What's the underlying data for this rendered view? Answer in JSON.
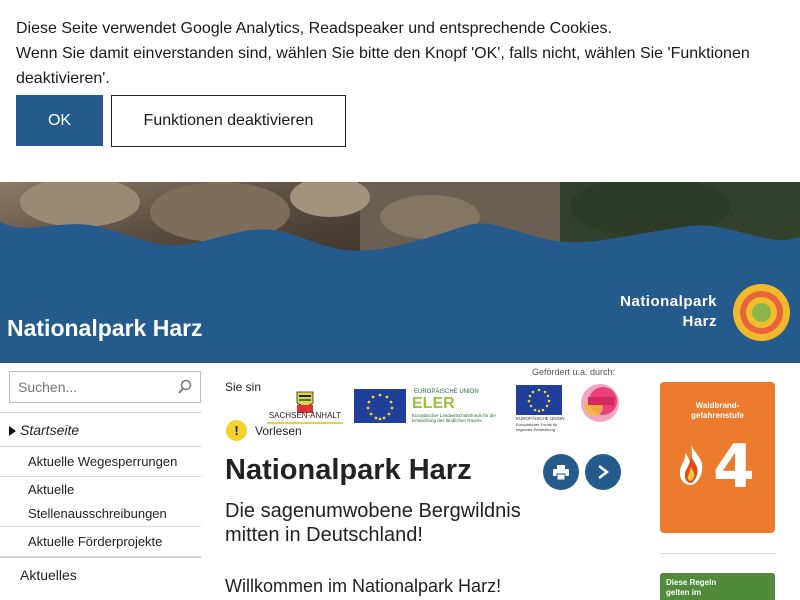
{
  "cookie": {
    "line1": "Diese Seite verwendet Google Analytics, Readspeaker und entsprechende Cookies.",
    "line2": "Wenn Sie damit einverstanden sind, wählen Sie bitte den Knopf 'OK', falls nicht, wählen Sie 'Funktionen deaktivieren'.",
    "ok_label": "OK",
    "deactivate_label": "Funktionen deaktivieren"
  },
  "header": {
    "site_title": "Nationalpark Harz",
    "logo_text": "Nationalpark Harz"
  },
  "sidebar": {
    "search_placeholder": "Suchen...",
    "nav": {
      "home": "Startseite",
      "sub": [
        "Aktuelle Wegesperrungen",
        "Aktuelle Stellenausschreibungen",
        "Aktuelle Förderprojekte"
      ],
      "aktuelles": "Aktuelles"
    }
  },
  "main": {
    "partial_text": "Sie sin",
    "sponsor_label": "Gefördert u.a. durch:",
    "logos": {
      "sachsen_anhalt": "SACHSEN-ANHALT",
      "eler_title": "EUROPÄISCHE UNION",
      "eler_big": "ELER",
      "eler_desc": "Europäischer Landwirtschaftsfonds für die Entwicklung des ländlichen Raums",
      "efre_title": "EUROPÄISCHE UNION",
      "efre_desc": "Europäischer Fonds für regionale Entwicklung"
    },
    "readspeaker_label": "Vorlesen",
    "title": "Nationalpark Harz",
    "subtitle": "Die sagenumwobene Bergwildnis mitten in Deutschland!",
    "welcome": "Willkommen im Nationalpark Harz!"
  },
  "right": {
    "fire_title": "Waldbrand-\ngefahrenstufe",
    "fire_level": "4",
    "rules_text": "Diese Regeln\ngelten im"
  },
  "colors": {
    "brand_blue": "#245a8c",
    "fire_orange": "#ec7b2d",
    "rules_green": "#4f8b3a"
  }
}
